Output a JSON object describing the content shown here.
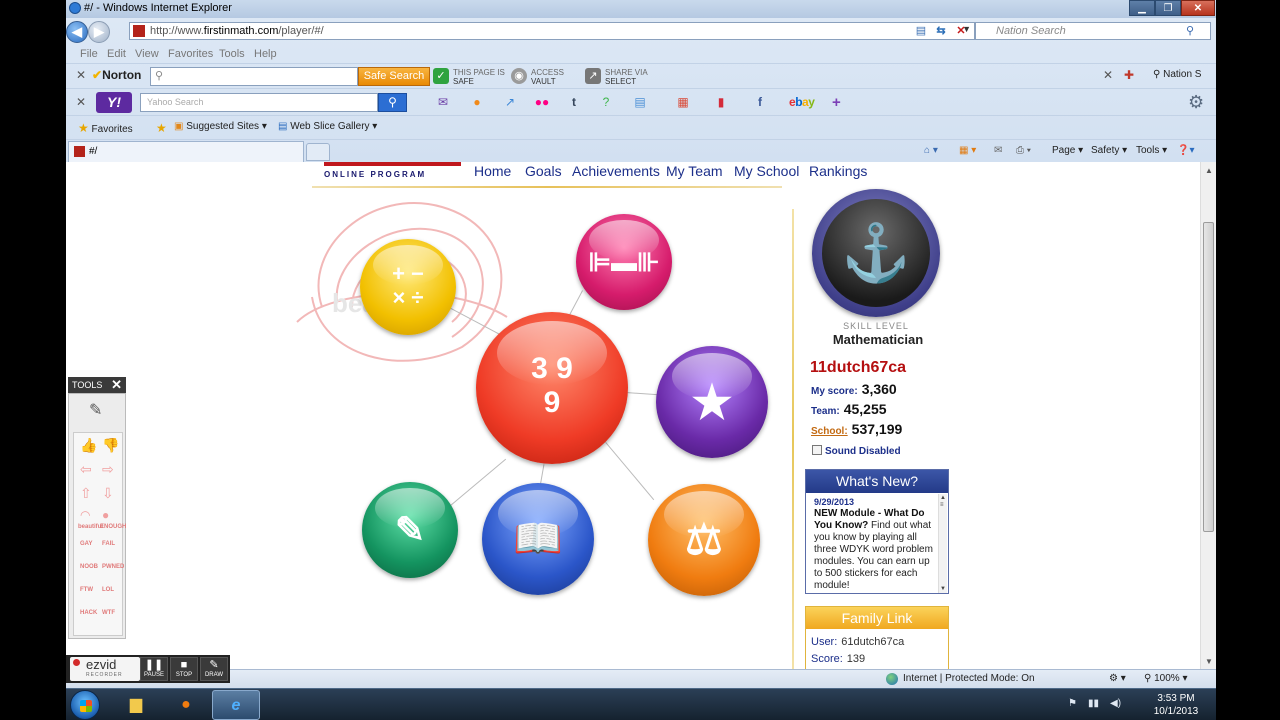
{
  "window": {
    "title": "#/ - Windows Internet Explorer",
    "url_prefix": "http://www.",
    "url_host": "firstinmath.com",
    "url_path": "/player/#/",
    "search_placeholder": "Nation Search"
  },
  "menu": [
    "File",
    "Edit",
    "View",
    "Favorites",
    "Tools",
    "Help"
  ],
  "norton": {
    "brand": "Norton",
    "safe_search_label": "Safe Search",
    "items": [
      {
        "line1": "THIS PAGE IS",
        "line2": "SAFE",
        "color": "#2fa33f",
        "icon": "check-icon"
      },
      {
        "line1": "ACCESS",
        "line2": "VAULT",
        "color": "#9a9a9a",
        "icon": "vault-icon"
      },
      {
        "line1": "SHARE VIA",
        "line2": "SELECT",
        "color": "#777777",
        "icon": "share-icon"
      }
    ],
    "nation_label": "Nation S"
  },
  "yahoo": {
    "logo": "Y!",
    "search_placeholder": "Yahoo Search",
    "ebay": [
      "e",
      "b",
      "a",
      "y"
    ]
  },
  "favorites": {
    "favorites_label": "Favorites",
    "suggested_label": "Suggested Sites",
    "webslice_label": "Web Slice Gallery"
  },
  "tab": {
    "label": "#/"
  },
  "commands": {
    "page": "Page",
    "safety": "Safety",
    "tools": "Tools"
  },
  "site": {
    "logo_sub": "ONLINE PROGRAM",
    "nav": [
      "Home",
      "Goals",
      "Achievements",
      "My Team",
      "My School",
      "Rankings"
    ]
  },
  "modules": [
    {
      "name": "math-operations",
      "glyph": "+ −\n× ÷",
      "color": "#f2c000"
    },
    {
      "name": "fitness",
      "glyph": "⊫▬⊪",
      "color": "#d61c6c"
    },
    {
      "name": "24-game",
      "glyph": "3 9\n9",
      "color": "#ef3b26"
    },
    {
      "name": "stickers",
      "glyph": "★",
      "color": "#6a2aa8"
    },
    {
      "name": "worksheets",
      "glyph": "✎",
      "color": "#149460"
    },
    {
      "name": "reading",
      "glyph": "📖",
      "color": "#2b56c9"
    },
    {
      "name": "measurement",
      "glyph": "⚖",
      "color": "#f07c10"
    }
  ],
  "doodle_text": "beautiful",
  "sidebar": {
    "skill_level_label": "SKILL LEVEL",
    "skill_level_value": "Mathematician",
    "username": "11dutch67ca",
    "my_score_label": "My score:",
    "my_score_value": "3,360",
    "team_label": "Team:",
    "team_value": "45,255",
    "school_label": "School:",
    "school_value": "537,199",
    "sound_label": "Sound Disabled",
    "whats_new_title": "What's New?",
    "whats_new_date": "9/29/2013",
    "whats_new_headline": "NEW Module - What Do You Know?",
    "whats_new_body": " Find out what you know by playing all three WDYK word problem modules. You can earn up to 500 stickers for each module!",
    "family_link_title": "Family Link",
    "family_user_label": "User:",
    "family_user_value": "61dutch67ca",
    "family_score_label": "Score:",
    "family_score_value": "139"
  },
  "ezvid": {
    "tools_label": "TOOLS",
    "brand": "ezvid",
    "brand_sub": "RECORDER",
    "pause": "PAUSE",
    "stop": "STOP",
    "draw": "DRAW",
    "stamp_labels": [
      "beautiful",
      "fail",
      "ok",
      "win"
    ],
    "stamps": [
      "GAY",
      "FAIL",
      "NOOB",
      "PWNED",
      "FTW",
      "LOL",
      "HACK",
      "WTF",
      "beautiful",
      "ENOUGH"
    ]
  },
  "status": {
    "zone": "Internet | Protected Mode: On",
    "zoom": "100%"
  },
  "taskbar": {
    "time": "3:53 PM",
    "date": "10/1/2013"
  }
}
